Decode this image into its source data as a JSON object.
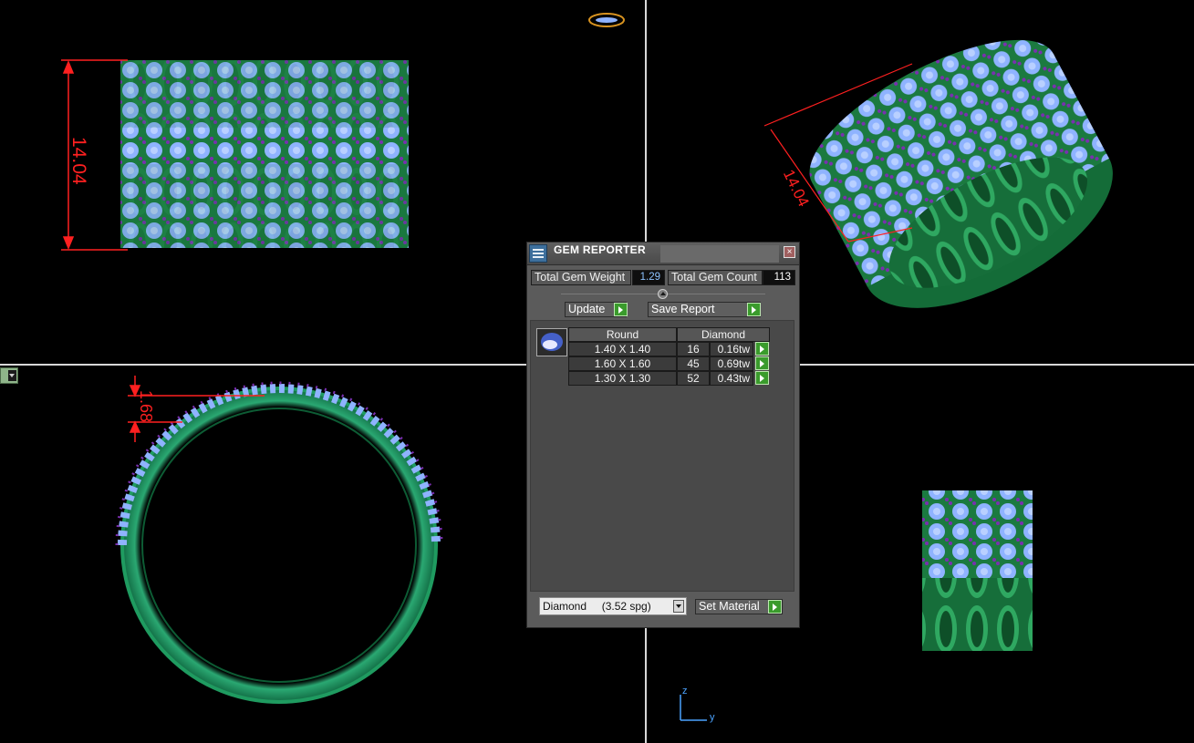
{
  "viewport": {
    "dimensions": {
      "width": "14.04",
      "side_width": "14.04",
      "top_height": "1.68"
    },
    "axis": {
      "z": "z",
      "y": "y"
    }
  },
  "gem_reporter": {
    "title": "GEM REPORTER",
    "total_gem_weight_label": "Total Gem Weight",
    "total_gem_weight": "1.29",
    "total_gem_count_label": "Total Gem Count",
    "total_gem_count": "113",
    "update_label": "Update",
    "save_report_label": "Save Report",
    "table": {
      "shape_header": "Round",
      "material_header": "Diamond",
      "rows": [
        {
          "size": "1.40 X 1.40",
          "count": "16",
          "weight": "0.16tw"
        },
        {
          "size": "1.60 X 1.60",
          "count": "45",
          "weight": "0.69tw"
        },
        {
          "size": "1.30 X 1.30",
          "count": "52",
          "weight": "0.43tw"
        }
      ]
    },
    "material_select": "Diamond     (3.52 spg)",
    "set_material_label": "Set Material"
  },
  "colors": {
    "metal": "#1e8a4c",
    "gem": "#8fb3ff",
    "prong": "#7a2fb0",
    "dimension": "#ff2020",
    "grid": "#d8d8d8"
  }
}
